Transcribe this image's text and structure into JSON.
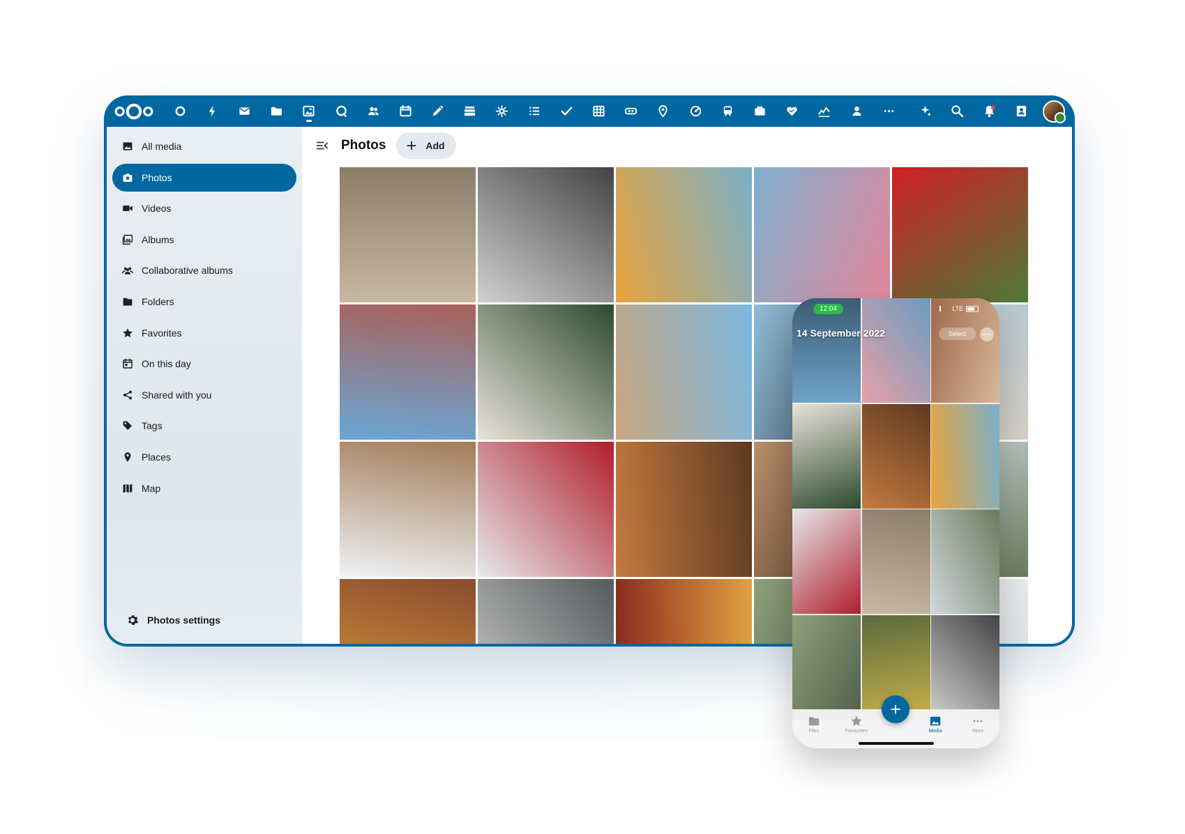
{
  "topbar": {
    "apps": [
      "dashboard",
      "activity",
      "mail",
      "files",
      "photos",
      "talk",
      "contacts",
      "calendar",
      "notes",
      "deck",
      "integration",
      "tasks-list",
      "tasks",
      "tables",
      "cospend",
      "maps",
      "analytics",
      "transport",
      "forms",
      "donate",
      "stocks",
      "user",
      "more"
    ],
    "active_app": "photos",
    "right": [
      "assistant",
      "search",
      "notifications",
      "contacts-menu"
    ]
  },
  "sidebar": {
    "items": [
      {
        "label": "All media",
        "icon": "image-icon"
      },
      {
        "label": "Photos",
        "icon": "camera-icon",
        "active": true
      },
      {
        "label": "Videos",
        "icon": "video-icon"
      },
      {
        "label": "Albums",
        "icon": "albums-icon"
      },
      {
        "label": "Collaborative albums",
        "icon": "people-icon"
      },
      {
        "label": "Folders",
        "icon": "folder-icon"
      },
      {
        "label": "Favorites",
        "icon": "star-icon"
      },
      {
        "label": "On this day",
        "icon": "calendar-icon"
      },
      {
        "label": "Shared with you",
        "icon": "share-icon"
      },
      {
        "label": "Tags",
        "icon": "tag-icon"
      },
      {
        "label": "Places",
        "icon": "pin-icon"
      },
      {
        "label": "Map",
        "icon": "map-icon"
      }
    ],
    "settings_label": "Photos settings"
  },
  "main": {
    "title": "Photos",
    "add_label": "Add"
  },
  "colors": {
    "accent": "#0067a1",
    "sidebar_bg": "#e5ebf1",
    "active_fg": "#ffffff"
  },
  "photos": [
    {
      "desc": "beach-surfers",
      "colors": [
        "#c8b8a2",
        "#8b7d6a"
      ]
    },
    {
      "desc": "bw-fountain",
      "colors": [
        "#d0d0d0",
        "#444444"
      ]
    },
    {
      "desc": "turkish-breakfast",
      "colors": [
        "#e9a43c",
        "#7ab0c9"
      ]
    },
    {
      "desc": "ice-cream-sea",
      "colors": [
        "#7fb0d0",
        "#e4869a"
      ]
    },
    {
      "desc": "red-phone-booth",
      "colors": [
        "#cf1f24",
        "#4e7a3a"
      ]
    },
    {
      "desc": "colorful-street",
      "colors": [
        "#6aa7d6",
        "#a9615a"
      ]
    },
    {
      "desc": "chapel-window",
      "colors": [
        "#e8e2d8",
        "#2d4a2f"
      ]
    },
    {
      "desc": "ancient-library",
      "colors": [
        "#c9a77f",
        "#7ab8e2"
      ]
    },
    {
      "desc": "lighthouse",
      "colors": [
        "#8fbcd6",
        "#3a4a5a"
      ]
    },
    {
      "desc": "sea-view",
      "colors": [
        "#a9c4d3",
        "#d8d0c6"
      ]
    },
    {
      "desc": "camels-snow",
      "colors": [
        "#f0f2f5",
        "#a27b57"
      ]
    },
    {
      "desc": "red-roses",
      "colors": [
        "#e6e9ec",
        "#b01e2b"
      ]
    },
    {
      "desc": "arched-hall",
      "colors": [
        "#c47a3e",
        "#5e3a22"
      ]
    },
    {
      "desc": "interior",
      "colors": [
        "#b8906a",
        "#4f3525"
      ]
    },
    {
      "desc": "trees-coast",
      "colors": [
        "#cfd7dc",
        "#6b7b5c"
      ]
    },
    {
      "desc": "painted-house",
      "colors": [
        "#d99a3c",
        "#8a4b2f"
      ]
    },
    {
      "desc": "bridge-of-sighs",
      "colors": [
        "#c8c8c4",
        "#555a5e"
      ]
    },
    {
      "desc": "venice-masks",
      "colors": [
        "#8c2a1f",
        "#e0a040"
      ]
    },
    {
      "desc": "fountain-garden",
      "colors": [
        "#8ea07a",
        "#51604a"
      ]
    },
    {
      "desc": "white-sky",
      "colors": [
        "#eceff1",
        "#d9dee2"
      ]
    }
  ],
  "phone": {
    "time": "12:04",
    "network": "LTE",
    "date_header": "14 September 2022",
    "select_label": "Select",
    "tabs": [
      {
        "label": "Files",
        "icon": "folder-icon"
      },
      {
        "label": "Favourites",
        "icon": "star-icon"
      },
      {
        "label": "Media",
        "icon": "image-icon",
        "active": true
      },
      {
        "label": "More",
        "icon": "more-icon"
      }
    ],
    "photos": [
      {
        "colors": [
          "#6fa3c9",
          "#3b5c74"
        ]
      },
      {
        "colors": [
          "#e6a1a8",
          "#6b9bc0"
        ]
      },
      {
        "colors": [
          "#a0674a",
          "#d7b89a"
        ]
      },
      {
        "colors": [
          "#e8e2d8",
          "#2d4a2f"
        ]
      },
      {
        "colors": [
          "#c47a3e",
          "#5e3a22"
        ]
      },
      {
        "colors": [
          "#e9a43c",
          "#7ab0c9"
        ]
      },
      {
        "colors": [
          "#e6e9ec",
          "#b01e2b"
        ]
      },
      {
        "colors": [
          "#c8b8a2",
          "#8b7d6a"
        ]
      },
      {
        "colors": [
          "#cfd7dc",
          "#6b7b5c"
        ]
      },
      {
        "colors": [
          "#8ea07a",
          "#51604a"
        ]
      },
      {
        "colors": [
          "#5b6a3c",
          "#c9b24a"
        ]
      },
      {
        "colors": [
          "#d0d0d0",
          "#444444"
        ]
      }
    ]
  }
}
